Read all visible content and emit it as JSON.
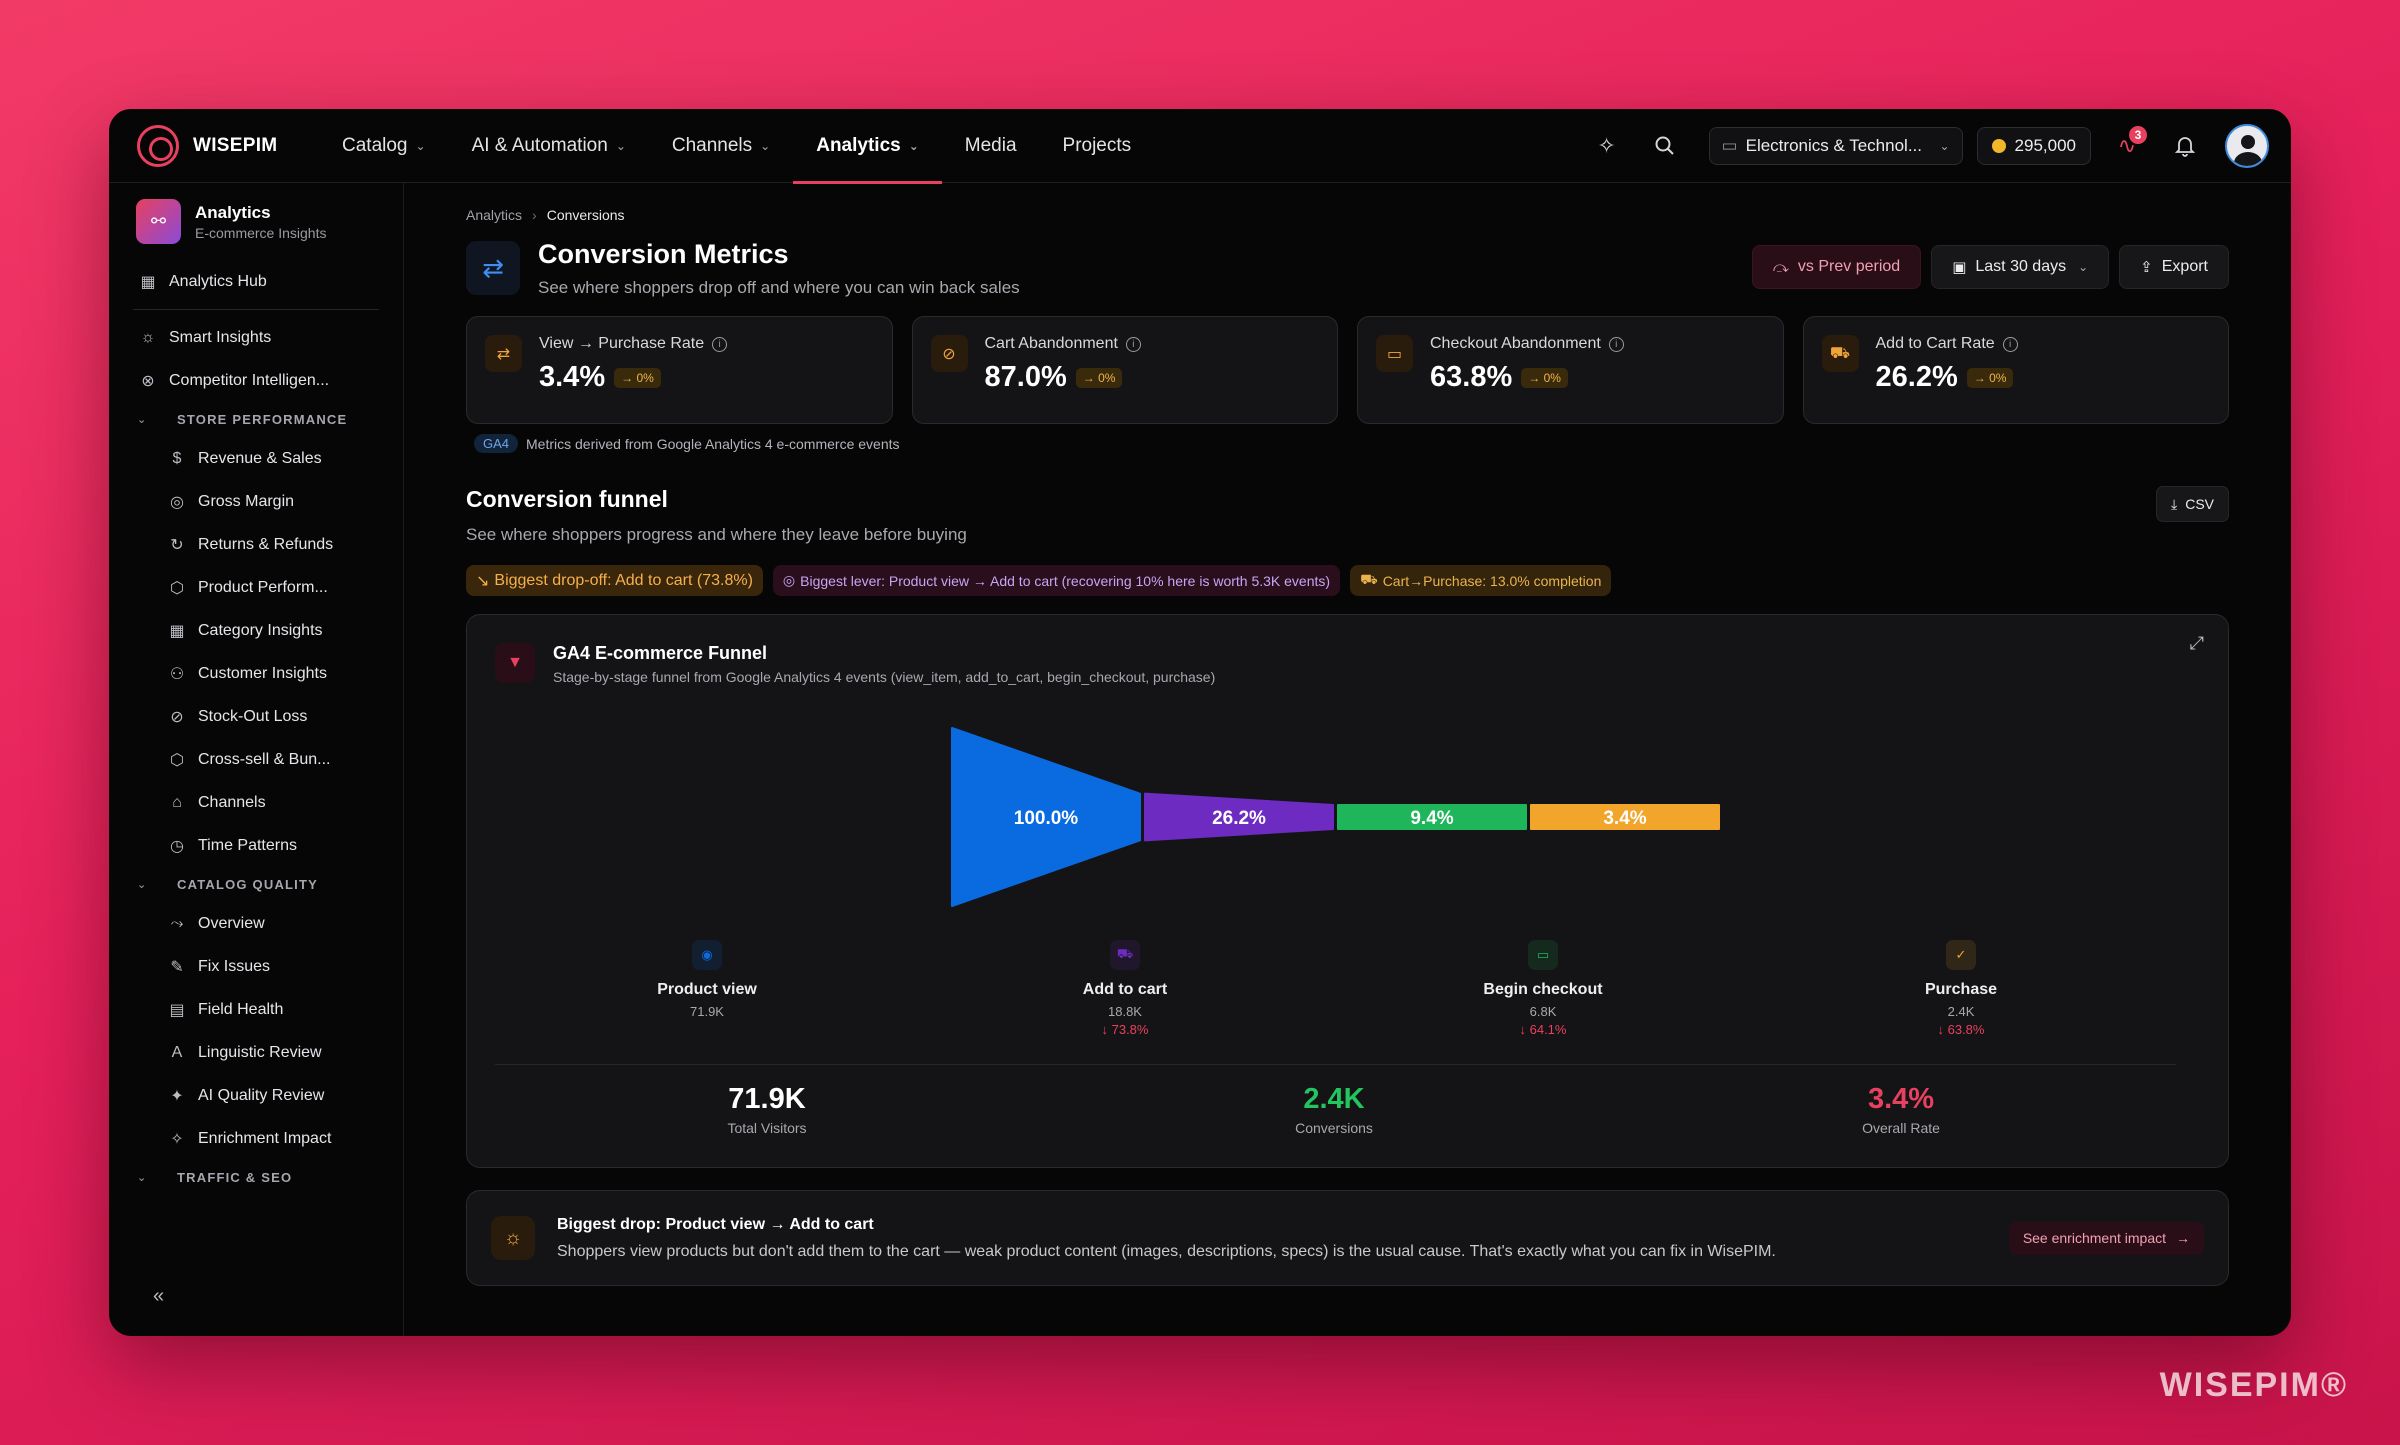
{
  "brand": {
    "name": "WISEPIM",
    "watermark": "WISEPIM®"
  },
  "nav": [
    {
      "label": "Catalog",
      "has_menu": true,
      "active": false
    },
    {
      "label": "AI & Automation",
      "has_menu": true,
      "active": false
    },
    {
      "label": "Channels",
      "has_menu": true,
      "active": false
    },
    {
      "label": "Analytics",
      "has_menu": true,
      "active": true
    },
    {
      "label": "Media",
      "has_menu": false,
      "active": false
    },
    {
      "label": "Projects",
      "has_menu": false,
      "active": false
    }
  ],
  "topbar": {
    "store": "Electronics & Technol...",
    "credits": "295,000",
    "notification_count": "3"
  },
  "sidebar": {
    "title": "Analytics",
    "subtitle": "E-commerce Insights",
    "hub": "Analytics Hub",
    "top_items": [
      {
        "label": "Smart Insights",
        "icon": "lightbulb-icon",
        "glyph": "☼"
      },
      {
        "label": "Competitor Intelligen...",
        "icon": "binoculars-icon",
        "glyph": "⊗"
      }
    ],
    "sections": [
      {
        "title": "STORE PERFORMANCE",
        "items": [
          {
            "label": "Revenue & Sales",
            "icon": "dollar-icon",
            "glyph": "$"
          },
          {
            "label": "Gross Margin",
            "icon": "coin-icon",
            "glyph": "◎"
          },
          {
            "label": "Returns & Refunds",
            "icon": "refresh-icon",
            "glyph": "↻"
          },
          {
            "label": "Product Perform...",
            "icon": "box-icon",
            "glyph": "⬡"
          },
          {
            "label": "Category Insights",
            "icon": "grid-icon",
            "glyph": "▦"
          },
          {
            "label": "Customer Insights",
            "icon": "users-icon",
            "glyph": "⚇"
          },
          {
            "label": "Stock-Out Loss",
            "icon": "package-off-icon",
            "glyph": "⊘"
          },
          {
            "label": "Cross-sell & Bun...",
            "icon": "package-icon",
            "glyph": "⬡"
          },
          {
            "label": "Channels",
            "icon": "store-icon",
            "glyph": "⌂"
          },
          {
            "label": "Time Patterns",
            "icon": "clock-icon",
            "glyph": "◷"
          }
        ]
      },
      {
        "title": "CATALOG QUALITY",
        "items": [
          {
            "label": "Overview",
            "icon": "route-icon",
            "glyph": "⤳"
          },
          {
            "label": "Fix Issues",
            "icon": "wrench-icon",
            "glyph": "✎"
          },
          {
            "label": "Field Health",
            "icon": "table-icon",
            "glyph": "▤"
          },
          {
            "label": "Linguistic Review",
            "icon": "translate-icon",
            "glyph": "A"
          },
          {
            "label": "AI Quality Review",
            "icon": "sparkles-icon",
            "glyph": "✦"
          },
          {
            "label": "Enrichment Impact",
            "icon": "sparkles-icon",
            "glyph": "✧"
          }
        ]
      },
      {
        "title": "TRAFFIC & SEO",
        "items": []
      }
    ]
  },
  "breadcrumb": {
    "parent": "Analytics",
    "current": "Conversions"
  },
  "page": {
    "title": "Conversion Metrics",
    "subtitle": "See where shoppers drop off and where you can win back sales",
    "compare_btn": "vs Prev period",
    "range_btn": "Last 30 days",
    "export_btn": "Export"
  },
  "kpis": [
    {
      "label": "View → Purchase Rate",
      "value": "3.4%",
      "delta": "→ 0%",
      "icon": "arrows-icon"
    },
    {
      "label": "Cart Abandonment",
      "value": "87.0%",
      "delta": "→ 0%",
      "icon": "cart-off-icon"
    },
    {
      "label": "Checkout Abandonment",
      "value": "63.8%",
      "delta": "→ 0%",
      "icon": "card-off-icon"
    },
    {
      "label": "Add to Cart Rate",
      "value": "26.2%",
      "delta": "→ 0%",
      "icon": "cart-plus-icon"
    }
  ],
  "ga_note": {
    "tag": "GA4",
    "text": "Metrics derived from Google Analytics 4 e-commerce events"
  },
  "funnel_section": {
    "title": "Conversion funnel",
    "subtitle": "See where shoppers progress and where they leave before buying",
    "csv_btn": "CSV",
    "chips": [
      "Biggest drop-off: Add to cart (73.8%)",
      "Biggest lever: Product view → Add to cart (recovering 10% here is worth 5.3K events)",
      "Cart→Purchase: 13.0% completion"
    ]
  },
  "funnel_card": {
    "title": "GA4 E-commerce Funnel",
    "subtitle": "Stage-by-stage funnel from Google Analytics 4 events (view_item, add_to_cart, begin_checkout, purchase)"
  },
  "chart_data": {
    "type": "funnel",
    "stages": [
      {
        "name": "Product view",
        "count": "71.9K",
        "percent": 100.0,
        "label": "100.0%",
        "drop": "",
        "color": "#0a6be0"
      },
      {
        "name": "Add to cart",
        "count": "18.8K",
        "percent": 26.2,
        "label": "26.2%",
        "drop": "↓ 73.8%",
        "color": "#6e2bc2"
      },
      {
        "name": "Begin checkout",
        "count": "6.8K",
        "percent": 9.4,
        "label": "9.4%",
        "drop": "↓ 64.1%",
        "color": "#1fb55a"
      },
      {
        "name": "Purchase",
        "count": "2.4K",
        "percent": 3.4,
        "label": "3.4%",
        "drop": "↓ 63.8%",
        "color": "#f2a52b"
      }
    ]
  },
  "totals": [
    {
      "value": "71.9K",
      "label": "Total Visitors",
      "color": "#ffffff"
    },
    {
      "value": "2.4K",
      "label": "Conversions",
      "color": "#22c55e"
    },
    {
      "value": "3.4%",
      "label": "Overall Rate",
      "color": "#e8405f"
    }
  ],
  "insight": {
    "title": "Biggest drop: Product view → Add to cart",
    "text": "Shoppers view products but don't add them to the cart — weak product content (images, descriptions, specs) is the usual cause. That's exactly what you can fix in WisePIM.",
    "button": "See enrichment impact"
  }
}
